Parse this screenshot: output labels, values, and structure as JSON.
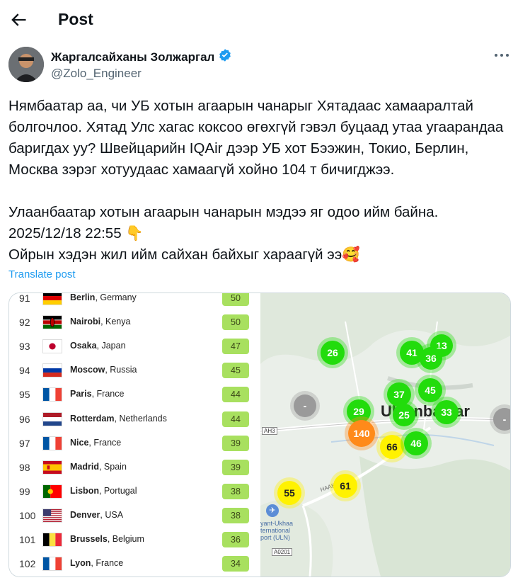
{
  "header": {
    "title": "Post"
  },
  "author": {
    "name": "Жаргалсайханы Золжаргал",
    "handle": "@Zolo_Engineer"
  },
  "post": {
    "paragraphs": [
      "Нямбаатар аа, чи УБ хотын агаарын чанарыг Хятадаас хамааралтай болгочлоо. Хятад Улс хагас коксоо өгөхгүй гэвэл буцаад утаа угаарандаа баригдах уу? Швейцарийн IQAir дээр УБ хот Бээжин, Токио, Берлин, Москва зэрэг хотуудаас хамаагүй хойно 104 т бичигджээ.",
      "Улаанбаатар хотын агаарын чанарын мэдээ яг одоо ийм байна.",
      "2025/12/18 22:55 👇",
      "Ойрын хэдэн жил ийм сайхан байхыг хараагүй ээ🥰"
    ],
    "translate_label": "Translate post"
  },
  "ranking": [
    {
      "rank": "91",
      "city": "Berlin",
      "country": ", Germany",
      "score": "50",
      "flag": "de"
    },
    {
      "rank": "92",
      "city": "Nairobi",
      "country": ", Kenya",
      "score": "50",
      "flag": "ke"
    },
    {
      "rank": "93",
      "city": "Osaka",
      "country": ", Japan",
      "score": "47",
      "flag": "jp"
    },
    {
      "rank": "94",
      "city": "Moscow",
      "country": ", Russia",
      "score": "45",
      "flag": "ru"
    },
    {
      "rank": "95",
      "city": "Paris",
      "country": ", France",
      "score": "44",
      "flag": "fr"
    },
    {
      "rank": "96",
      "city": "Rotterdam",
      "country": ", Netherlands",
      "score": "44",
      "flag": "nl"
    },
    {
      "rank": "97",
      "city": "Nice",
      "country": ", France",
      "score": "39",
      "flag": "fr"
    },
    {
      "rank": "98",
      "city": "Madrid",
      "country": ", Spain",
      "score": "39",
      "flag": "es"
    },
    {
      "rank": "99",
      "city": "Lisbon",
      "country": ", Portugal",
      "score": "38",
      "flag": "pt"
    },
    {
      "rank": "100",
      "city": "Denver",
      "country": ", USA",
      "score": "38",
      "flag": "us"
    },
    {
      "rank": "101",
      "city": "Brussels",
      "country": ", Belgium",
      "score": "36",
      "flag": "be"
    },
    {
      "rank": "102",
      "city": "Lyon",
      "country": ", France",
      "score": "34",
      "flag": "fr"
    }
  ],
  "map": {
    "city_label": "Ulaanbaatar",
    "road_labels": [
      "AH3",
      "A0201"
    ],
    "street_label": "HAABAM",
    "airport_label": "yant-Ukhaa\nternational\nport (ULN)",
    "markers": [
      {
        "value": "26",
        "level": "green"
      },
      {
        "value": "41",
        "level": "green"
      },
      {
        "value": "13",
        "level": "green"
      },
      {
        "value": "36",
        "level": "green"
      },
      {
        "value": "37",
        "level": "green"
      },
      {
        "value": "45",
        "level": "green"
      },
      {
        "value": "-",
        "level": "grey"
      },
      {
        "value": "29",
        "level": "green"
      },
      {
        "value": "25",
        "level": "green"
      },
      {
        "value": "33",
        "level": "green"
      },
      {
        "value": "140",
        "level": "orange"
      },
      {
        "value": "66",
        "level": "yellow"
      },
      {
        "value": "46",
        "level": "green"
      },
      {
        "value": "61",
        "level": "yellow"
      },
      {
        "value": "55",
        "level": "yellow"
      },
      {
        "value": "-",
        "level": "grey"
      }
    ]
  },
  "colors": {
    "accent": "#1d9bf0",
    "good": "#a8e05f",
    "verified": "#1d9bf0"
  }
}
